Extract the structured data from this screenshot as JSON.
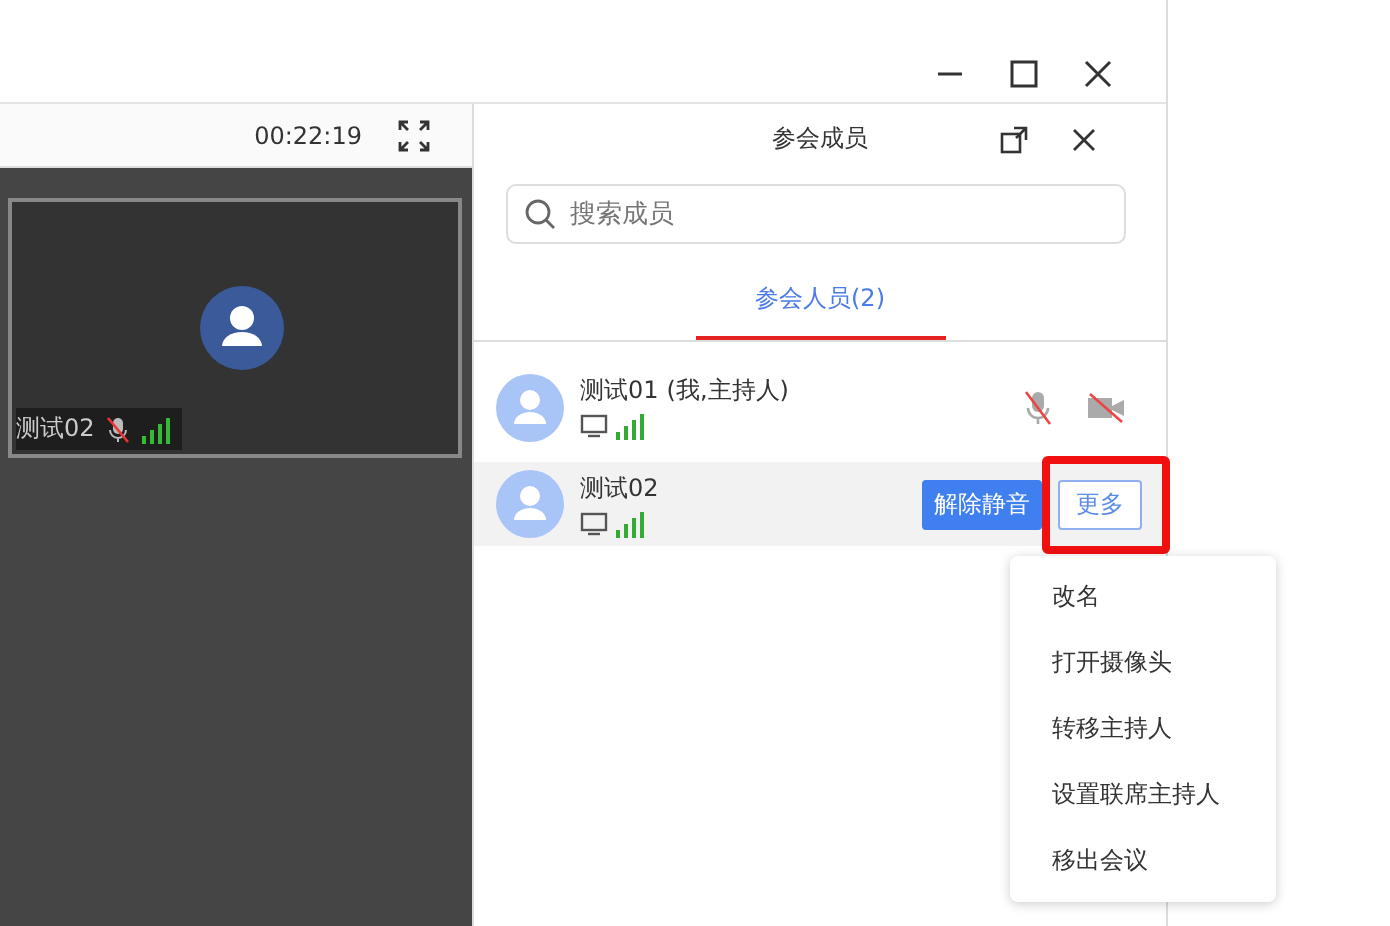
{
  "call": {
    "duration": "00:22:19"
  },
  "video_tile": {
    "name": "测试02",
    "mic_muted": true
  },
  "panel": {
    "title": "参会成员",
    "search": {
      "placeholder": "搜索成员"
    },
    "tabs": [
      {
        "label": "参会人员(2)",
        "selected": true
      }
    ],
    "members": [
      {
        "name": "测试01",
        "note": "(我,主持人)",
        "mic_muted": true,
        "camera_off": true,
        "selected": false
      },
      {
        "name": "测试02",
        "selected": true,
        "actions": [
          {
            "label": "解除静音",
            "kind": "primary"
          },
          {
            "label": "更多",
            "kind": "outline",
            "highlighted": true
          }
        ]
      }
    ]
  },
  "menu": {
    "items": [
      "改名",
      "打开摄像头",
      "转移主持人",
      "设置联席主持人",
      "移出会议"
    ]
  }
}
